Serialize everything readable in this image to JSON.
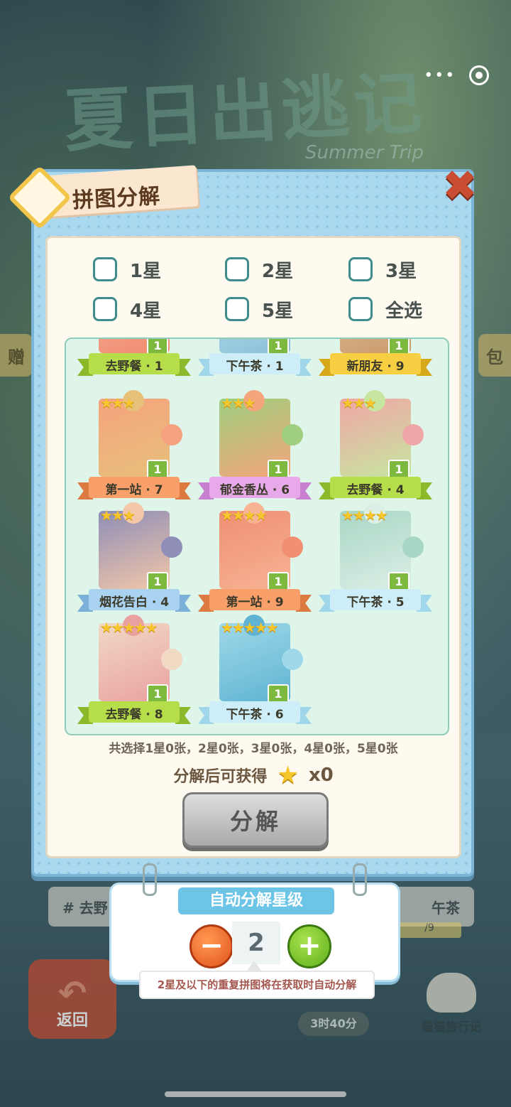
{
  "background": {
    "game_title": "夏日出逃记",
    "game_subtitle": "Summer Trip",
    "side_left_text": "赠",
    "side_right_text": "包",
    "strip_left_text": "# 去野",
    "strip_right_text": "午茶",
    "progress_text": "/9",
    "back_label": "返回",
    "timer_text": "3时40分",
    "cat_travel_label": "猫猫旅行记"
  },
  "panel": {
    "title": "拼图分解",
    "close_glyph": "✖",
    "checkboxes": [
      {
        "label": "1星",
        "checked": false
      },
      {
        "label": "2星",
        "checked": false
      },
      {
        "label": "3星",
        "checked": false
      },
      {
        "label": "4星",
        "checked": false
      },
      {
        "label": "5星",
        "checked": false
      },
      {
        "label": "全选",
        "checked": false
      }
    ],
    "cards": [
      {
        "name": "去野餐 · 1",
        "stars": "",
        "count": "1",
        "ribbon": "#b6dd4a",
        "ribbon_dark": "#8cb82c",
        "pic": "#f5b8a8",
        "knob": "#f08a6c"
      },
      {
        "name": "下午茶 · 1",
        "stars": "",
        "count": "1",
        "ribbon": "#cdeef8",
        "ribbon_dark": "#9fd6ea",
        "pic": "#bfe3f1",
        "knob": "#8ac0d8"
      },
      {
        "name": "新朋友 · 9",
        "stars": "",
        "count": "1",
        "ribbon": "#f7cf43",
        "ribbon_dark": "#d8a81c",
        "pic": "#e7c49e",
        "knob": "#c89a6a"
      },
      {
        "name": "第一站 · 7",
        "stars": "★★★",
        "count": "1",
        "ribbon": "#f9a06a",
        "ribbon_dark": "#dc7a42",
        "pic": "#f5a37e",
        "knob": "#e7c07a"
      },
      {
        "name": "郁金香丛 · 6",
        "stars": "★★★",
        "count": "1",
        "ribbon": "#e7a9ea",
        "ribbon_dark": "#c87fcf",
        "pic": "#9fcf7e",
        "knob": "#f5a57e"
      },
      {
        "name": "去野餐 · 4",
        "stars": "★★★",
        "count": "1",
        "ribbon": "#b6dd4a",
        "ribbon_dark": "#8cb82c",
        "pic": "#f0a6a6",
        "knob": "#c6e6a0"
      },
      {
        "name": "烟花告白 · 4",
        "stars": "★★★",
        "count": "1",
        "ribbon": "#a9d3f0",
        "ribbon_dark": "#7bb0d8",
        "pic": "#8e8eb8",
        "knob": "#f3c7a8"
      },
      {
        "name": "第一站 · 9",
        "stars": "★★★★",
        "count": "1",
        "ribbon": "#f9a06a",
        "ribbon_dark": "#dc7a42",
        "pic": "#f08f72",
        "knob": "#f7b394"
      },
      {
        "name": "下午茶 · 5",
        "stars": "★★★★",
        "count": "1",
        "ribbon": "#cdeef8",
        "ribbon_dark": "#9fd6ea",
        "pic": "#a8d6c4",
        "knob": "#dcefe6"
      },
      {
        "name": "去野餐 · 8",
        "stars": "★★★★★",
        "count": "1",
        "ribbon": "#b6dd4a",
        "ribbon_dark": "#8cb82c",
        "pic": "#f1d9c4",
        "knob": "#e9a1a1"
      },
      {
        "name": "下午茶 · 6",
        "stars": "★★★★★",
        "count": "1",
        "ribbon": "#cdeef8",
        "ribbon_dark": "#9fd6ea",
        "pic": "#9fd8e8",
        "knob": "#5eb4d2"
      }
    ],
    "summary": "共选择1星0张，2星0张，3星0张，4星0张，5星0张",
    "gain_label": "分解后可获得",
    "gain_value": "x0",
    "decompose_label": "分解"
  },
  "auto": {
    "title": "自动分解星级",
    "level": "2",
    "minus": "−",
    "plus": "+",
    "tip": "2星及以下的重复拼图将在获取时自动分解"
  }
}
